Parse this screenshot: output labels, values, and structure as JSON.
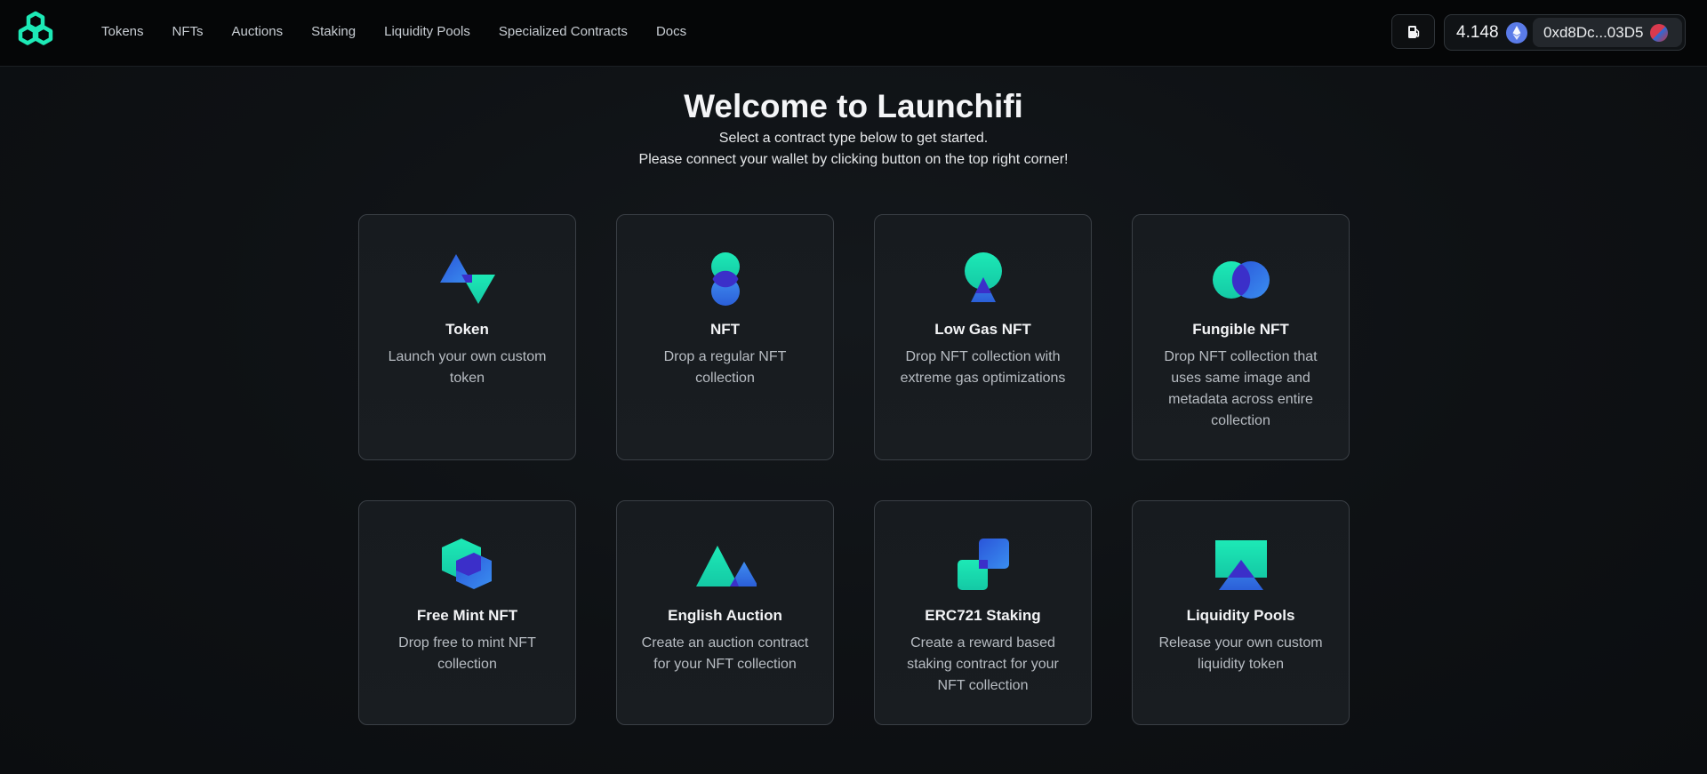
{
  "nav": {
    "items": [
      {
        "label": "Tokens"
      },
      {
        "label": "NFTs"
      },
      {
        "label": "Auctions"
      },
      {
        "label": "Staking"
      },
      {
        "label": "Liquidity Pools"
      },
      {
        "label": "Specialized Contracts"
      },
      {
        "label": "Docs"
      }
    ]
  },
  "wallet": {
    "balance": "4.148",
    "address": "0xd8Dc...03D5"
  },
  "hero": {
    "title": "Welcome to Launchifi",
    "line1": "Select a contract type below to get started.",
    "line2": "Please connect your wallet by clicking button on the top right corner!"
  },
  "cards": [
    {
      "title": "Token",
      "desc": "Launch your own custom token",
      "icon": "token-icon"
    },
    {
      "title": "NFT",
      "desc": "Drop a regular NFT collection",
      "icon": "nft-icon"
    },
    {
      "title": "Low Gas NFT",
      "desc": "Drop NFT collection with extreme gas optimizations",
      "icon": "low-gas-nft-icon"
    },
    {
      "title": "Fungible NFT",
      "desc": "Drop NFT collection that uses same image and metadata across entire collection",
      "icon": "fungible-nft-icon"
    },
    {
      "title": "Free Mint NFT",
      "desc": "Drop free to mint NFT collection",
      "icon": "free-mint-nft-icon"
    },
    {
      "title": "English Auction",
      "desc": "Create an auction contract for your NFT collection",
      "icon": "english-auction-icon"
    },
    {
      "title": "ERC721 Staking",
      "desc": "Create a reward based staking contract for your NFT collection",
      "icon": "erc721-staking-icon"
    },
    {
      "title": "Liquidity Pools",
      "desc": "Release your own custom liquidity token",
      "icon": "liquidity-pools-icon"
    }
  ],
  "colors": {
    "accent_teal": "#1de9b6",
    "accent_blue": "#2f6fe0",
    "accent_indigo": "#3b3fcf"
  }
}
